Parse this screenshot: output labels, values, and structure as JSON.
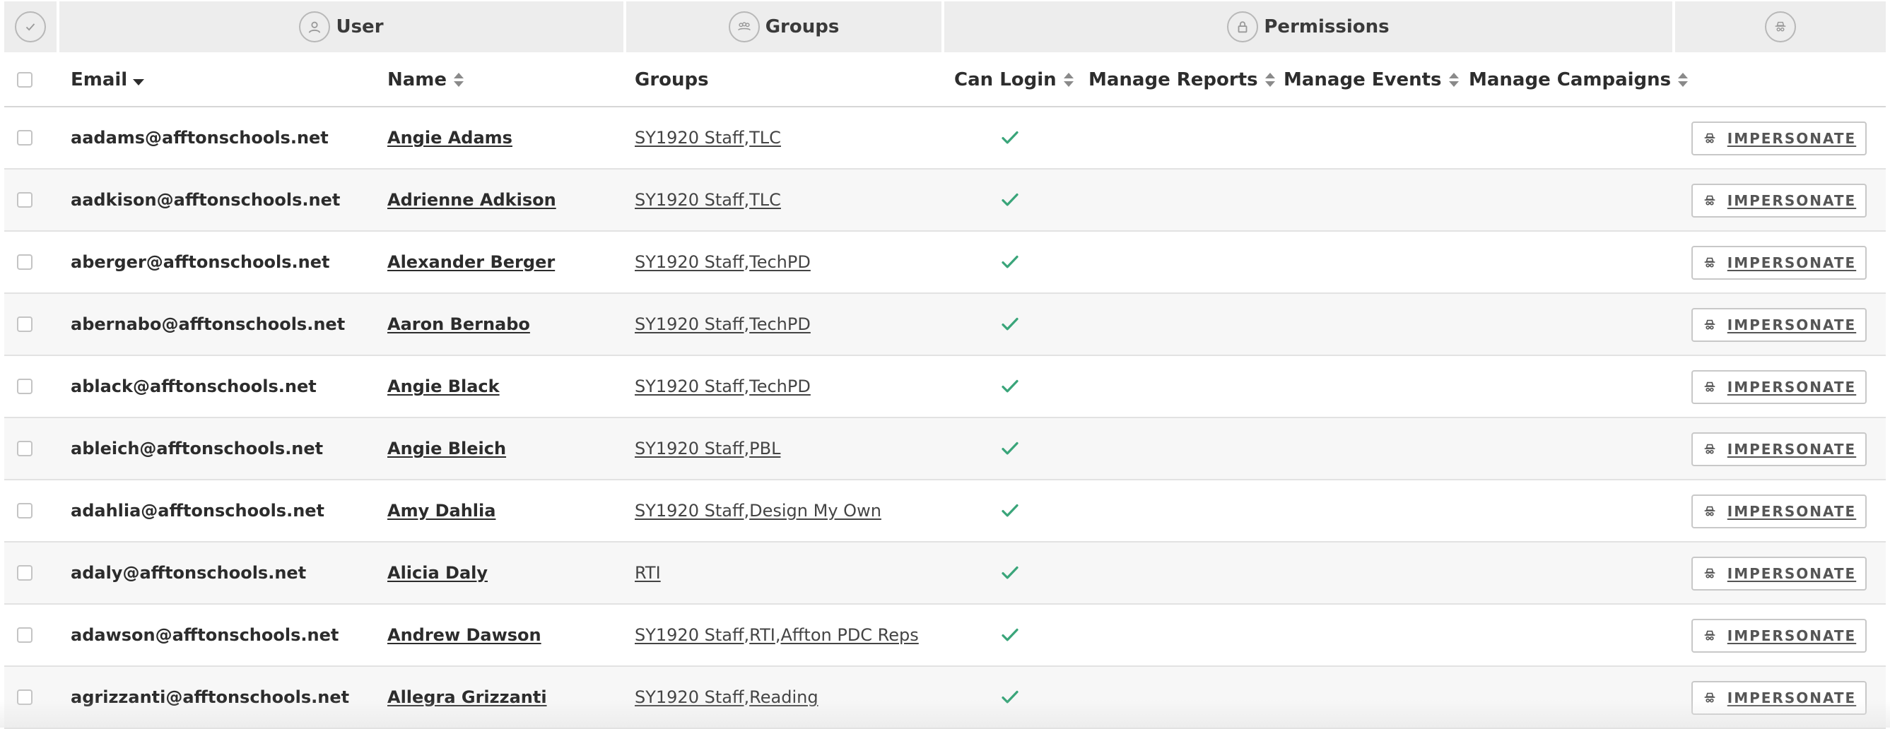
{
  "group_headers": {
    "user": "User",
    "groups": "Groups",
    "permissions": "Permissions"
  },
  "columns": {
    "email": "Email",
    "name": "Name",
    "groups": "Groups",
    "can_login": "Can Login",
    "manage_reports": "Manage Reports",
    "manage_events": "Manage Events",
    "manage_campaigns": "Manage Campaigns"
  },
  "impersonate_label": "IMPERSONATE",
  "colors": {
    "check": "#3aa57a",
    "header_bg": "#ededed",
    "alt_row_bg": "#f7f7f7"
  },
  "rows": [
    {
      "email": "aadams@afftonschools.net",
      "name": "Angie Adams",
      "groups": [
        "SY1920 Staff",
        "TLC"
      ],
      "can_login": true
    },
    {
      "email": "aadkison@afftonschools.net",
      "name": "Adrienne Adkison",
      "groups": [
        "SY1920 Staff",
        "TLC"
      ],
      "can_login": true
    },
    {
      "email": "aberger@afftonschools.net",
      "name": "Alexander Berger",
      "groups": [
        "SY1920 Staff",
        "TechPD"
      ],
      "can_login": true
    },
    {
      "email": "abernabo@afftonschools.net",
      "name": "Aaron Bernabo",
      "groups": [
        "SY1920 Staff",
        "TechPD"
      ],
      "can_login": true
    },
    {
      "email": "ablack@afftonschools.net",
      "name": "Angie Black",
      "groups": [
        "SY1920 Staff",
        "TechPD"
      ],
      "can_login": true
    },
    {
      "email": "ableich@afftonschools.net",
      "name": "Angie Bleich",
      "groups": [
        "SY1920 Staff",
        "PBL"
      ],
      "can_login": true
    },
    {
      "email": "adahlia@afftonschools.net",
      "name": "Amy Dahlia",
      "groups": [
        "SY1920 Staff",
        "Design My Own"
      ],
      "can_login": true
    },
    {
      "email": "adaly@afftonschools.net",
      "name": "Alicia Daly",
      "groups": [
        "RTI"
      ],
      "can_login": true
    },
    {
      "email": "adawson@afftonschools.net",
      "name": "Andrew Dawson",
      "groups": [
        "SY1920 Staff",
        "RTI",
        "Affton PDC Reps"
      ],
      "can_login": true
    },
    {
      "email": "agrizzanti@afftonschools.net",
      "name": "Allegra Grizzanti",
      "groups": [
        "SY1920 Staff",
        "Reading"
      ],
      "can_login": true
    }
  ]
}
